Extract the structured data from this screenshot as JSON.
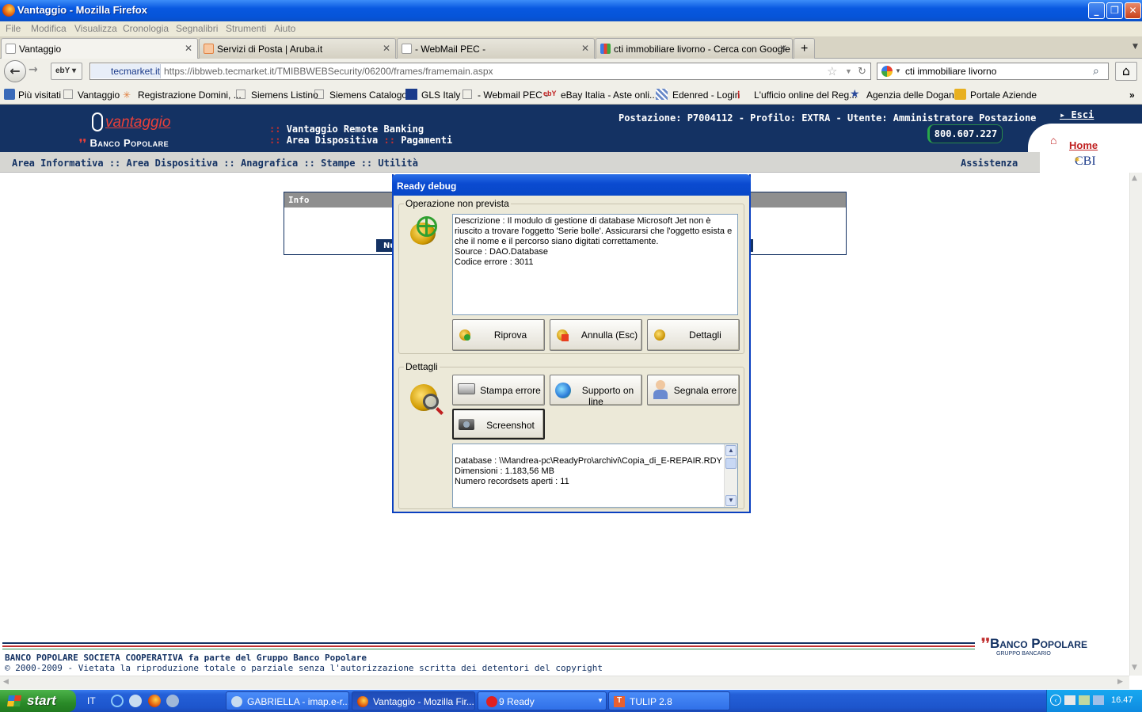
{
  "window": {
    "title": "Vantaggio - Mozilla Firefox"
  },
  "menu": [
    "File",
    "Modifica",
    "Visualizza",
    "Cronologia",
    "Segnalibri",
    "Strumenti",
    "Aiuto"
  ],
  "tabs": [
    {
      "label": "Vantaggio"
    },
    {
      "label": "Servizi di Posta | Aruba.it"
    },
    {
      "label": "- WebMail PEC -"
    },
    {
      "label": "cti immobiliare livorno - Cerca con Google"
    }
  ],
  "address": {
    "site": "tecmarket.it",
    "url": "https://ibbweb.tecmarket.it/TMIBBWEBSecurity/06200/frames/framemain.aspx"
  },
  "search": {
    "value": "cti immobiliare livorno"
  },
  "bookmarks": [
    "Più visitati",
    "Vantaggio",
    "Registrazione Domini, ...",
    "Siemens Listino",
    "Siemens Catalogo",
    "GLS Italy",
    "- Webmail PEC -",
    "eBay Italia - Aste onli...",
    "Edenred - Login",
    "L'ufficio online del Reg...",
    "Agenzia delle Dogane",
    "Portale Aziende"
  ],
  "page": {
    "logo_main": "vantaggio",
    "logo_bank": "Banco Popolare",
    "app_line1": "Vantaggio Remote Banking",
    "app_line2a": "Area Dispositiva",
    "app_line2b": "Pagamenti",
    "status": "Postazione: P7004112 - Profilo: EXTRA - Utente: Amministratore Postazione",
    "phone": "800.607.227",
    "exit": "Esci",
    "home": "Home",
    "subnav": "Area Informativa :: Area Dispositiva :: Anagrafica :: Stampe :: Utilità",
    "assist": "Assistenza",
    "cbi": "CBI",
    "info_header": "Info",
    "info_btn": "Nu",
    "footer_bank": "Banco Popolare",
    "footer_group": "GRUPPO BANCARIO",
    "footer_line1": "BANCO POPOLARE SOCIETA COOPERATIVA fa parte del Gruppo Banco Popolare",
    "footer_line2": "© 2000-2009 - Vietata la riproduzione totale o parziale senza l'autorizzazione scritta dei detentori del copyright"
  },
  "dialog": {
    "title": "Ready debug",
    "group1": "Operazione non prevista",
    "message": "Descrizione : Il modulo di gestione di database Microsoft Jet non è riuscito a trovare l'oggetto 'Serie bolle'. Assicurarsi che l'oggetto esista e che il nome e il percorso siano digitati correttamente.",
    "source": "Source : DAO.Database",
    "code": "Codice errore : 3011",
    "btn_retry": "Riprova",
    "btn_cancel": "Annulla (Esc)",
    "btn_details": "Dettagli",
    "group2": "Dettagli",
    "btn_print": "Stampa errore",
    "btn_support": "Supporto on line",
    "btn_report": "Segnala errore",
    "btn_screenshot": "Screenshot",
    "details": [
      "Database : \\\\Mandrea-pc\\ReadyPro\\archivi\\Copia_di_E-REPAIR.RDY",
      "Dimensioni : 1.183,56 MB",
      "Numero recordsets aperti : 11"
    ]
  },
  "taskbar": {
    "start": "start",
    "lang": "IT",
    "tasks": [
      "GABRIELLA - imap.e-r...",
      "Vantaggio - Mozilla Fir...",
      "9 Ready",
      "TULIP 2.8"
    ],
    "clock": "16.47"
  }
}
